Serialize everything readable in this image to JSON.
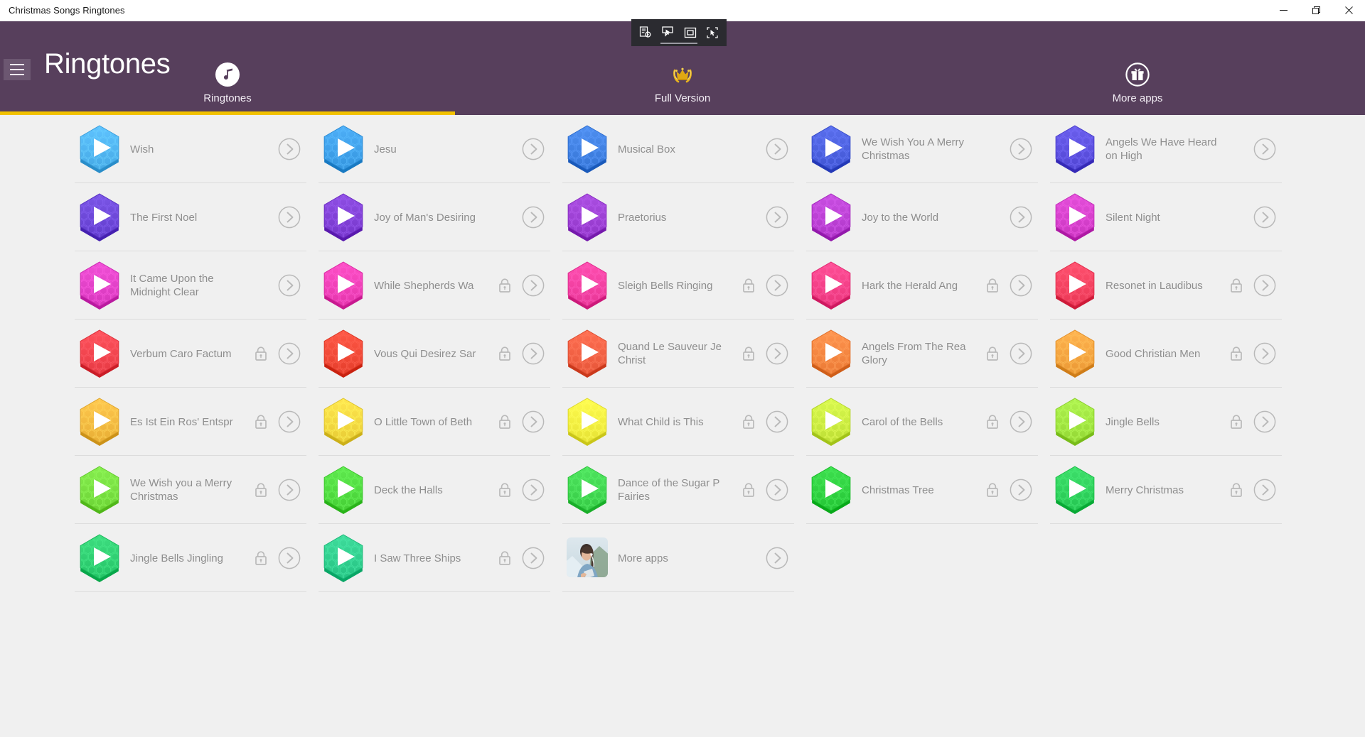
{
  "window": {
    "title": "Christmas Songs Ringtones",
    "buttons": [
      {
        "name": "minimize",
        "label": "Minimize"
      },
      {
        "name": "maximize",
        "label": "Restore"
      },
      {
        "name": "close",
        "label": "Close"
      }
    ]
  },
  "capture_toolbar": {
    "buttons": [
      {
        "name": "capture-settings-icon",
        "label": "Capture settings"
      },
      {
        "name": "cursor-capture-icon",
        "label": "Cursor capture"
      },
      {
        "name": "window-capture-icon",
        "label": "Window capture"
      },
      {
        "name": "region-capture-icon",
        "label": "Region capture"
      }
    ]
  },
  "header": {
    "title": "Ringtones",
    "menu_label": "Menu",
    "accent_color": "#f2c200",
    "background_color": "#573f5c"
  },
  "tabs": [
    {
      "label": "Ringtones",
      "icon": "music-note-icon",
      "active": true
    },
    {
      "label": "Full Version",
      "icon": "crown-icon",
      "active": false
    },
    {
      "label": "More apps",
      "icon": "gift-icon",
      "active": false
    }
  ],
  "ringtones": [
    {
      "title": "Wish",
      "color": "#4fb3ef",
      "locked": false
    },
    {
      "title": "Jesu",
      "color": "#3e9fe8",
      "locked": false
    },
    {
      "title": "Musical Box",
      "color": "#3f7fe0",
      "locked": false
    },
    {
      "title": "We Wish You A Merry Christmas",
      "color": "#4a5fdd",
      "locked": false
    },
    {
      "title": "Angels We Have Heard on High",
      "color": "#5b4fdd",
      "locked": false
    },
    {
      "title": "The First Noel",
      "color": "#6b46d6",
      "locked": false
    },
    {
      "title": "Joy of Man's Desiring",
      "color": "#7f3fd4",
      "locked": false
    },
    {
      "title": "Praetorius",
      "color": "#9b3fd2",
      "locked": false
    },
    {
      "title": "Joy to the World",
      "color": "#b93fd2",
      "locked": false
    },
    {
      "title": "Silent Night",
      "color": "#d43fca",
      "locked": false
    },
    {
      "title": "It Came Upon the Midnight Clear",
      "color": "#e040c6",
      "locked": false
    },
    {
      "title": "While Shepherds Wa",
      "color": "#ee3fb6",
      "locked": true
    },
    {
      "title": "Sleigh Bells Ringing",
      "color": "#f23fa0",
      "locked": true
    },
    {
      "title": "Hark the Herald Ang",
      "color": "#f43f86",
      "locked": true
    },
    {
      "title": "Resonet in Laudibus",
      "color": "#f4415f",
      "locked": true
    },
    {
      "title": "Verbum Caro Factum",
      "color": "#f0434d",
      "locked": true
    },
    {
      "title": "Vous Qui Desirez Sar",
      "color": "#ef4836",
      "locked": true
    },
    {
      "title": "Quand Le Sauveur Je Christ",
      "color": "#f05f42",
      "locked": true
    },
    {
      "title": "Angels From The Rea Glory",
      "color": "#f5843f",
      "locked": true
    },
    {
      "title": "Good Christian Men",
      "color": "#f5a33f",
      "locked": true
    },
    {
      "title": "Es Ist Ein Ros' Entspr",
      "color": "#f2b83f",
      "locked": true
    },
    {
      "title": "O Little Town of Beth",
      "color": "#f2d63f",
      "locked": true
    },
    {
      "title": "What Child is This",
      "color": "#f0ec3f",
      "locked": true
    },
    {
      "title": "Carol of the Bells",
      "color": "#c8e93f",
      "locked": true
    },
    {
      "title": "Jingle Bells",
      "color": "#9ee23f",
      "locked": true
    },
    {
      "title": "We Wish you a Merry Christmas",
      "color": "#76dd3f",
      "locked": true
    },
    {
      "title": "Deck the Halls",
      "color": "#4fd93f",
      "locked": true
    },
    {
      "title": "Dance of the Sugar P Fairies",
      "color": "#3fd44f",
      "locked": true
    },
    {
      "title": "Christmas Tree",
      "color": "#2ecf3f",
      "locked": true
    },
    {
      "title": "Merry Christmas",
      "color": "#2ecf5b",
      "locked": true
    },
    {
      "title": "Jingle Bells Jingling",
      "color": "#2ecd70",
      "locked": true
    },
    {
      "title": "I Saw Three Ships",
      "color": "#2fcc8c",
      "locked": true
    },
    {
      "title": "More apps",
      "color": "photo",
      "locked": false
    }
  ]
}
